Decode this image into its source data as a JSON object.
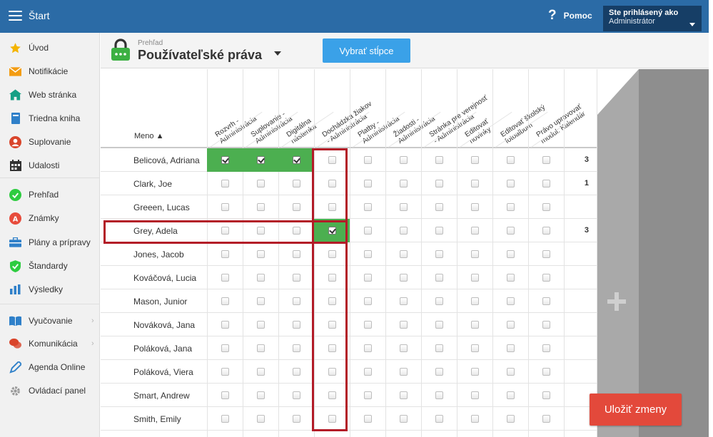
{
  "topbar": {
    "app_title": "Štart",
    "help_label": "Pomoc",
    "logged_in_as": "Ste prihlásený ako",
    "user_name": "Administrátor"
  },
  "sidebar": {
    "items": [
      {
        "label": "Úvod",
        "icon": "star-icon",
        "color": "#f4b400"
      },
      {
        "label": "Notifikácie",
        "icon": "envelope-icon",
        "color": "#f39c12"
      },
      {
        "label": "Web stránka",
        "icon": "home-icon",
        "color": "#16a085"
      },
      {
        "label": "Triedna kniha",
        "icon": "book-icon",
        "color": "#2f80c9"
      },
      {
        "label": "Suplovanie",
        "icon": "person-icon",
        "color": "#d9452b"
      },
      {
        "label": "Udalosti",
        "icon": "calendar-icon",
        "color": "#333333"
      },
      {
        "label": "Prehľad",
        "icon": "check-circle-icon",
        "color": "#2ecc40"
      },
      {
        "label": "Známky",
        "icon": "grade-icon",
        "color": "#e74c3c"
      },
      {
        "label": "Plány a prípravy",
        "icon": "briefcase-icon",
        "color": "#2f80c9"
      },
      {
        "label": "Štandardy",
        "icon": "shield-icon",
        "color": "#2ecc40"
      },
      {
        "label": "Výsledky",
        "icon": "bar-chart-icon",
        "color": "#2f80c9"
      },
      {
        "label": "Vyučovanie",
        "icon": "open-book-icon",
        "color": "#2f80c9",
        "has_submenu": true
      },
      {
        "label": "Komunikácia",
        "icon": "chat-icon",
        "color": "#d9452b",
        "has_submenu": true
      },
      {
        "label": "Agenda Online",
        "icon": "pen-icon",
        "color": "#2f80c9"
      },
      {
        "label": "Ovládací panel",
        "icon": "gear-icon",
        "color": "#999999"
      }
    ]
  },
  "header": {
    "breadcrumb": "Prehľad",
    "title": "Používateľské práva",
    "select_columns_label": "Vybrať stĺpce"
  },
  "table": {
    "name_header": "Meno ▲",
    "columns": [
      [
        "Rozvrh -",
        "Administrácia"
      ],
      [
        "Suplovanie -",
        "Administrácia"
      ],
      [
        "Digitálna",
        "nástenka"
      ],
      [
        "Dochádzka žiakov",
        "- Administrácia"
      ],
      [
        "Platby -",
        "Administrácia"
      ],
      [
        "Žiadosti -",
        "Administrácia"
      ],
      [
        "Stránka pre verejnosť",
        "- Administrácia"
      ],
      [
        "Editovať",
        "novinky"
      ],
      [
        "Editovať školský",
        "fotoalbum"
      ],
      [
        "Právo upravovať",
        "modul: Kalendár"
      ]
    ],
    "rows": [
      {
        "name": "Belicová, Adriana",
        "checked": [
          1,
          1,
          1,
          0,
          0,
          0,
          0,
          0,
          0,
          0
        ],
        "count": "3"
      },
      {
        "name": "Clark, Joe",
        "checked": [
          0,
          0,
          0,
          0,
          0,
          0,
          0,
          0,
          0,
          0
        ],
        "count": "1"
      },
      {
        "name": "Greeen, Lucas",
        "checked": [
          0,
          0,
          0,
          0,
          0,
          0,
          0,
          0,
          0,
          0
        ],
        "count": ""
      },
      {
        "name": "Grey, Adela",
        "checked": [
          0,
          0,
          0,
          1,
          0,
          0,
          0,
          0,
          0,
          0
        ],
        "count": "3"
      },
      {
        "name": "Jones, Jacob",
        "checked": [
          0,
          0,
          0,
          0,
          0,
          0,
          0,
          0,
          0,
          0
        ],
        "count": ""
      },
      {
        "name": "Kováčová, Lucia",
        "checked": [
          0,
          0,
          0,
          0,
          0,
          0,
          0,
          0,
          0,
          0
        ],
        "count": ""
      },
      {
        "name": "Mason, Junior",
        "checked": [
          0,
          0,
          0,
          0,
          0,
          0,
          0,
          0,
          0,
          0
        ],
        "count": ""
      },
      {
        "name": "Nováková, Jana",
        "checked": [
          0,
          0,
          0,
          0,
          0,
          0,
          0,
          0,
          0,
          0
        ],
        "count": ""
      },
      {
        "name": "Poláková, Jana",
        "checked": [
          0,
          0,
          0,
          0,
          0,
          0,
          0,
          0,
          0,
          0
        ],
        "count": ""
      },
      {
        "name": "Poláková, Viera",
        "checked": [
          0,
          0,
          0,
          0,
          0,
          0,
          0,
          0,
          0,
          0
        ],
        "count": ""
      },
      {
        "name": "Smart, Andrew",
        "checked": [
          0,
          0,
          0,
          0,
          0,
          0,
          0,
          0,
          0,
          0
        ],
        "count": ""
      },
      {
        "name": "Smith, Emily",
        "checked": [
          0,
          0,
          0,
          0,
          0,
          0,
          0,
          0,
          0,
          0
        ],
        "count": ""
      }
    ]
  },
  "footer": {
    "save_label": "Uložiť zmeny"
  },
  "colors": {
    "topbar": "#2b6ba6",
    "accent": "#3aa1e8",
    "save": "#e3493b",
    "checked_cell": "#4caf50",
    "highlight": "#b31b27"
  }
}
